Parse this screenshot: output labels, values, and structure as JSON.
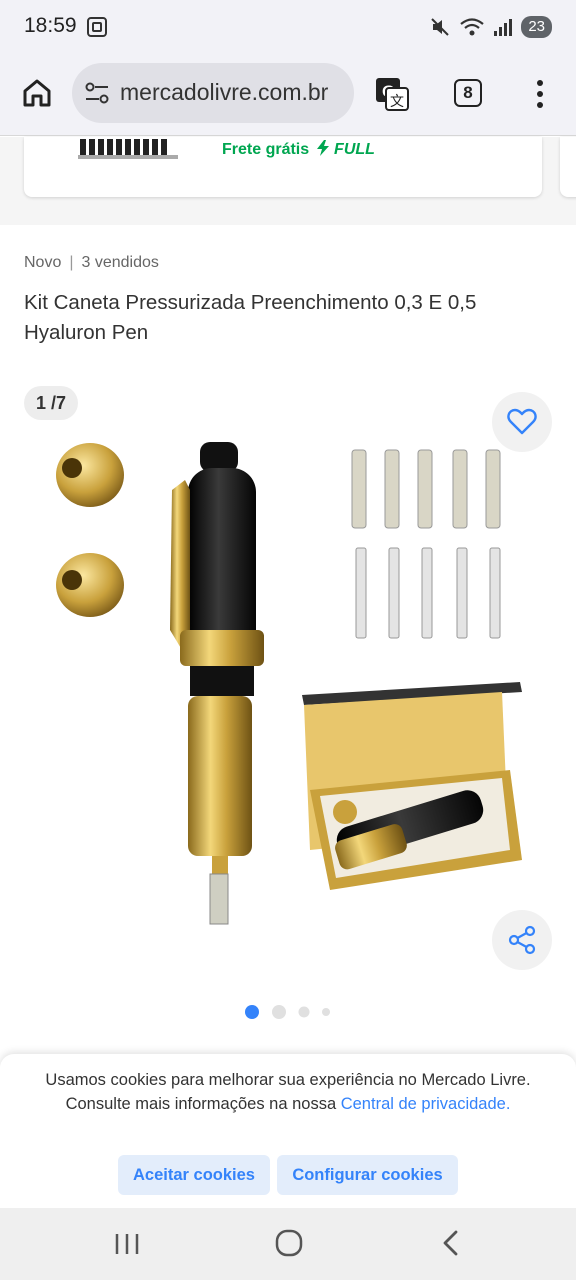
{
  "status_bar": {
    "time": "18:59",
    "battery": "23",
    "icons": [
      "screenshot-icon",
      "mute-icon",
      "wifi-icon",
      "signal-icon",
      "battery-icon"
    ]
  },
  "browser": {
    "url": "mercadolivre.com.br",
    "tab_count": "8",
    "icons": [
      "home-icon",
      "tune-icon",
      "translate-icon",
      "more-vert-icon"
    ]
  },
  "previous_card": {
    "shipping_label": "Frete grátis",
    "shipping_badge": "FULL",
    "shipping_color": "#00a650"
  },
  "product": {
    "condition": "Novo",
    "sold": "3 vendidos",
    "title": "Kit Caneta Pressurizada Preenchimento 0,3 E 0,5 Hyaluron Pen"
  },
  "gallery": {
    "counter": "1 /7",
    "current_image": 1,
    "total_images": 7,
    "dots": 4,
    "active_dot": 0,
    "icons": [
      "heart-icon",
      "share-icon"
    ]
  },
  "cookie_banner": {
    "text": "Usamos cookies para melhorar sua experiência no Mercado Livre. Consulte mais informações na nossa ",
    "link": "Central de privacidade.",
    "accept_label": "Aceitar cookies",
    "configure_label": "Configurar cookies",
    "accent_color": "#3483fa"
  },
  "nav_bar": {
    "icons": [
      "recents-icon",
      "home-circle-icon",
      "back-icon"
    ]
  }
}
